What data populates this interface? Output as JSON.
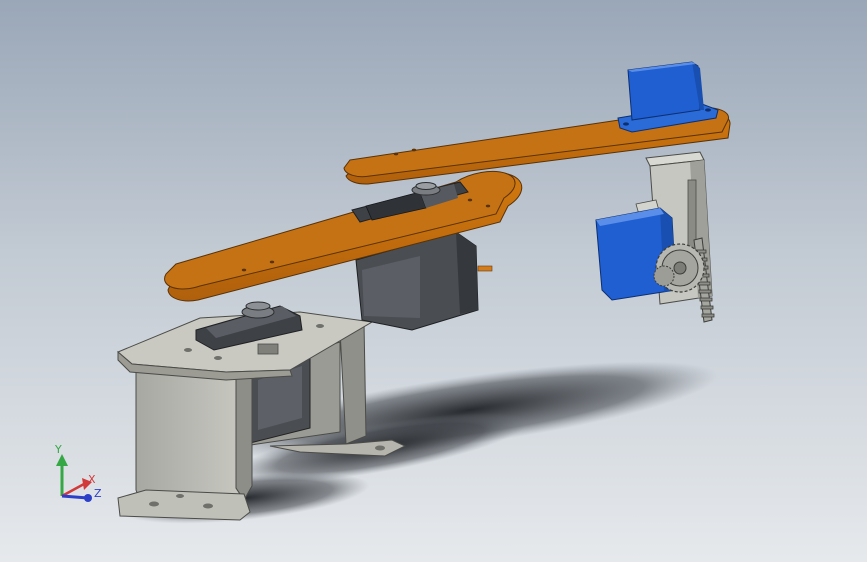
{
  "triad": {
    "x_label": "X",
    "y_label": "Y",
    "z_label": "Z",
    "x_color": "#d23a3a",
    "y_color": "#35a845",
    "z_color": "#2c3fc8"
  },
  "colors": {
    "background_top": "#9aa7b8",
    "background_bottom": "#e6e9ec",
    "arm_orange": "#c26c12",
    "arm_orange_top": "#b86a14",
    "servo_blue": "#1f5fd1",
    "bracket_gray": "#b9b9b1",
    "servo_dark": "#4a4d52"
  }
}
